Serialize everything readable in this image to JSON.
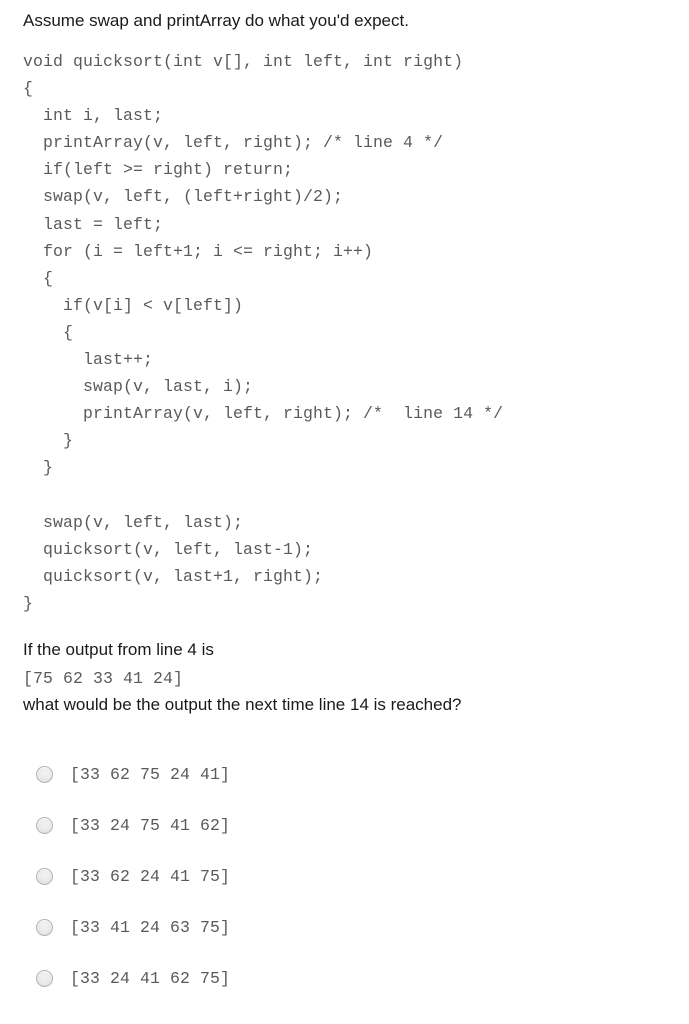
{
  "intro": {
    "text": "Assume swap and printArray do what you'd expect."
  },
  "code": {
    "language": "c",
    "lines": [
      "void quicksort(int v[], int left, int right)",
      "{",
      "  int i, last;",
      "  printArray(v, left, right); /* line 4 */",
      "  if(left >= right) return;",
      "  swap(v, left, (left+right)/2);",
      "  last = left;",
      "  for (i = left+1; i <= right; i++)",
      "  {",
      "    if(v[i] < v[left])",
      "    {",
      "      last++;",
      "      swap(v, last, i);",
      "      printArray(v, left, right); /*  line 14 */",
      "    }",
      "  }",
      "",
      "  swap(v, left, last);",
      "  quicksort(v, left, last-1);",
      "  quicksort(v, last+1, right);",
      "}"
    ]
  },
  "question": {
    "line1": "If the output from line 4 is",
    "given_output": "[75 62 33 41 24]",
    "line2": "what would be the output the next time line 14 is reached?"
  },
  "options": [
    {
      "id": "option-a",
      "label": "[33 62 75 24 41]",
      "selected": false
    },
    {
      "id": "option-b",
      "label": "[33 24 75 41 62]",
      "selected": false
    },
    {
      "id": "option-c",
      "label": "[33 62 24 41 75]",
      "selected": false
    },
    {
      "id": "option-d",
      "label": "[33 41 24 63 75]",
      "selected": false
    },
    {
      "id": "option-e",
      "label": "[33 24 41 62 75]",
      "selected": false
    }
  ],
  "colors": {
    "page_background": "#ffffff",
    "prose_text": "#1a1a1a",
    "code_text": "#5a5a5a",
    "radio_border": "#b4b4b4",
    "radio_fill": "#e8e8e8"
  }
}
